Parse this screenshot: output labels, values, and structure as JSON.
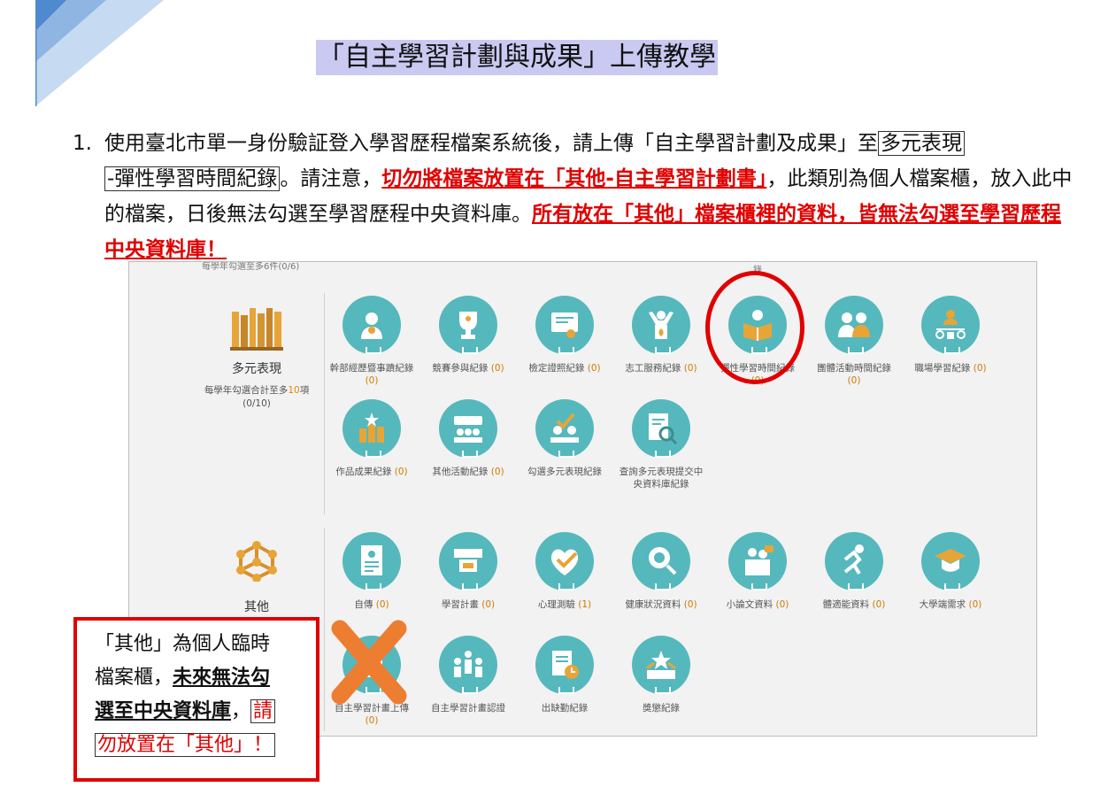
{
  "slide_title": "「自主學習計劃與成果」上傳教學",
  "paragraph": {
    "number": "1.",
    "seg1": "使用臺北市單一身份驗証登入學習歷程檔案系統後，請上傳「自主學習計劃及成果」至",
    "box1a": "多元表現",
    "box1b": "-彈性學習時間紀錄",
    "seg2": "。請注意，",
    "red1": "切勿將檔案放置在「其他-自主學習計劃書」",
    "seg3": "，此類別為個人檔案櫃，放入此中的檔案，日後無法勾選至學習歷程中央資料庫。",
    "red2": "所有放在「其他」檔案櫃裡的資料，皆無法勾選至學習歷程中央資料庫！"
  },
  "screenshot": {
    "top_cut_left": "每學年勾選至多6件(0/6)",
    "top_cut_mid": "錄",
    "group1": {
      "label": "多元表現",
      "note_prefix": "每學年勾選合計至多",
      "note_highlight": "10",
      "note_suffix": "項",
      "note_count": "(0/10)",
      "items": [
        {
          "icon": "group-icon",
          "label": "幹部經歷暨事蹟紀錄",
          "count": "(0)"
        },
        {
          "icon": "trophy-icon",
          "label": "競賽參與紀錄",
          "count": "(0)"
        },
        {
          "icon": "certificate-icon",
          "label": "檢定證照紀錄",
          "count": "(0)"
        },
        {
          "icon": "volunteer-icon",
          "label": "志工服務紀錄",
          "count": "(0)"
        },
        {
          "icon": "reading-person-icon",
          "label": "彈性學習時間紀錄",
          "count": "(0)"
        },
        {
          "icon": "team-icon",
          "label": "團體活動時間紀錄",
          "count": "(0)"
        },
        {
          "icon": "workplace-icon",
          "label": "職場學習紀錄",
          "count": "(0)"
        },
        {
          "icon": "achievement-icon",
          "label": "作品成果紀錄",
          "count": "(0)"
        },
        {
          "icon": "activity-icon",
          "label": "其他活動紀錄",
          "count": "(0)"
        },
        {
          "icon": "select-check-icon",
          "label": "勾選多元表現紀錄",
          "count": ""
        },
        {
          "icon": "document-search-icon",
          "label": "查詢多元表現提交中央資料庫紀錄",
          "count": ""
        }
      ]
    },
    "group2": {
      "label": "其他",
      "items": [
        {
          "icon": "autobiography-icon",
          "label": "自傳",
          "count": "(0)"
        },
        {
          "icon": "study-plan-icon",
          "label": "學習計畫",
          "count": "(0)"
        },
        {
          "icon": "psych-test-icon",
          "label": "心理測驗",
          "count": "(1)"
        },
        {
          "icon": "health-icon",
          "label": "健康狀況資料",
          "count": "(0)"
        },
        {
          "icon": "essay-icon",
          "label": "小論文資料",
          "count": "(0)"
        },
        {
          "icon": "fitness-icon",
          "label": "體適能資料",
          "count": "(0)"
        },
        {
          "icon": "graduation-cap-icon",
          "label": "大學端需求",
          "count": "(0)"
        },
        {
          "icon": "upload-plan-icon",
          "label": "自主學習計畫上傳",
          "count": "(0)"
        },
        {
          "icon": "plan-certify-icon",
          "label": "自主學習計畫認證",
          "count": ""
        },
        {
          "icon": "attendance-icon",
          "label": "出缺勤紀錄",
          "count": ""
        },
        {
          "icon": "award-icon",
          "label": "獎懲紀錄",
          "count": ""
        }
      ]
    }
  },
  "note": {
    "line1": "「其他」為個人臨時",
    "line2a": "檔案櫃，",
    "line2b": "未來無法勾",
    "line3a": "選至中央資料庫",
    "line3b": "，",
    "line3c": "請",
    "line4": "勿放置在「其他」！"
  },
  "colors": {
    "accent_red": "#e00000",
    "icon_teal": "#55b8bd",
    "title_highlight": "#c9c9f2",
    "count_orange": "#d07a00"
  }
}
